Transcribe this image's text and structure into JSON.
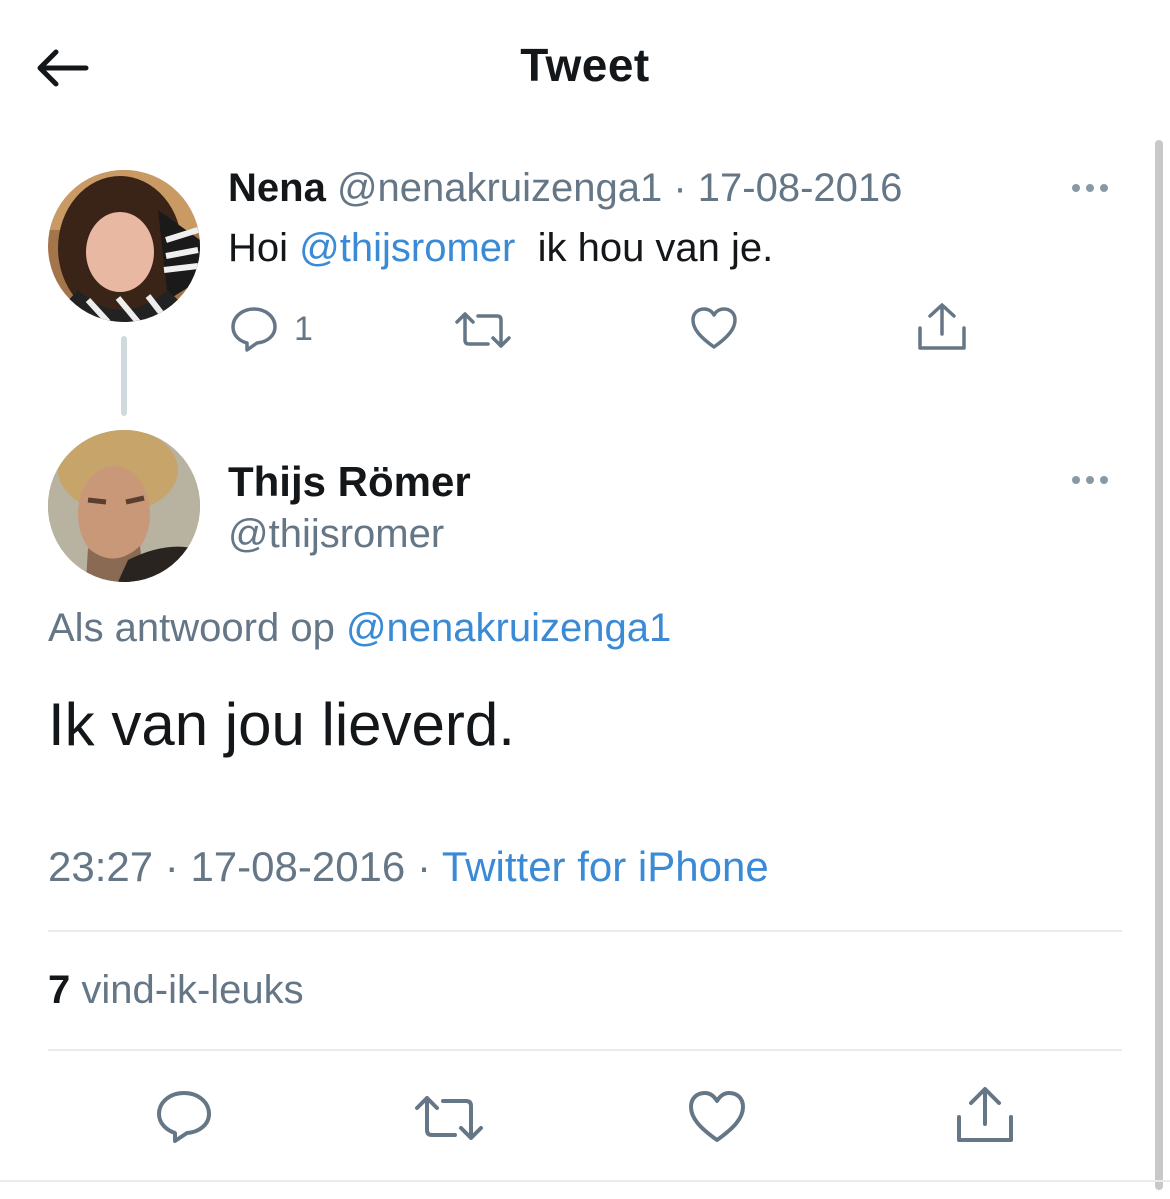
{
  "header": {
    "title": "Tweet"
  },
  "parent_tweet": {
    "name": "Nena",
    "handle": "@nenakruizenga1",
    "separator": "·",
    "date": "17-08-2016",
    "text_before": "Hoi ",
    "mention": "@thijsromer",
    "text_after": "  ik hou van je.",
    "reply_count": "1"
  },
  "main_tweet": {
    "name": "Thijs Römer",
    "handle": "@thijsromer",
    "reply_prefix": "Als antwoord op ",
    "reply_mention": "@nenakruizenga1",
    "text": "Ik van jou lieverd.",
    "time": "23:27",
    "separator": " · ",
    "date": "17-08-2016",
    "source": "Twitter for iPhone",
    "likes_count": "7",
    "likes_label": " vind-ik-leuks"
  },
  "icons": {
    "back": "arrow-left-icon",
    "more": "more-horizontal-icon",
    "reply": "speech-bubble-icon",
    "retweet": "retweet-icon",
    "like": "heart-icon",
    "share": "share-icon"
  },
  "colors": {
    "accent": "#3a8ad6",
    "secondary_text": "#657786",
    "primary_text": "#14171a",
    "icon": "#657786",
    "divider": "#e6ecf0"
  }
}
